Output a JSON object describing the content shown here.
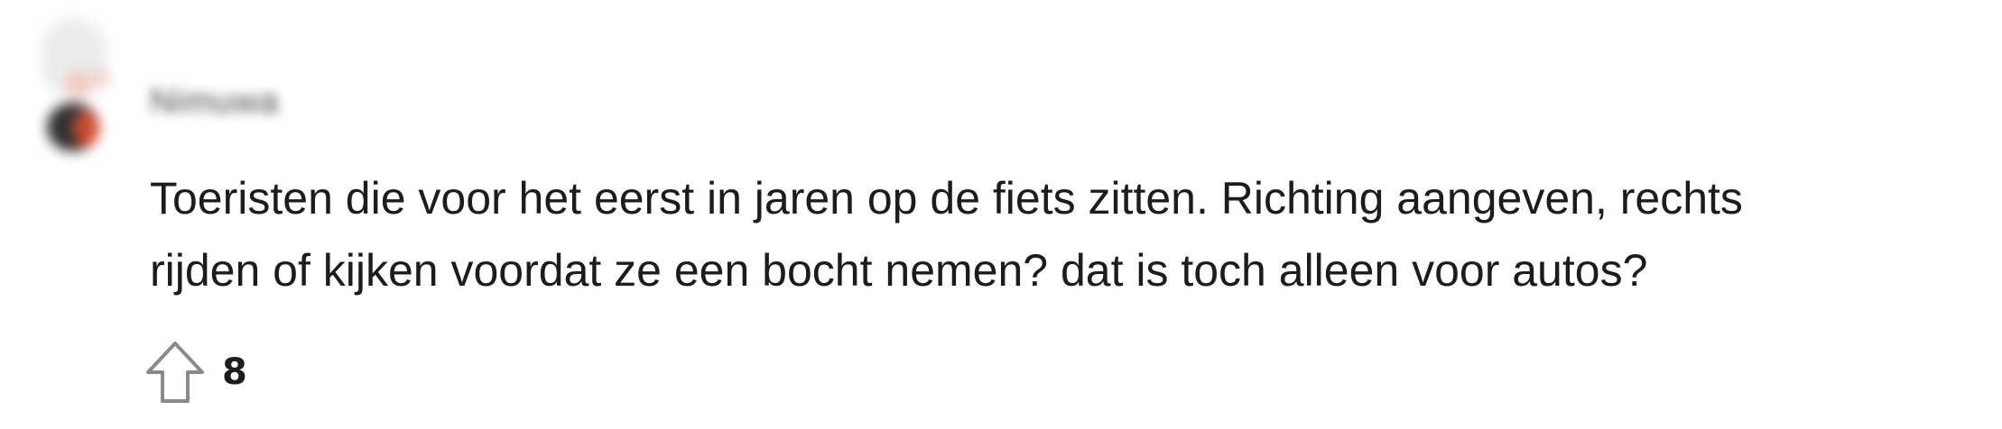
{
  "comment": {
    "username": "Nimuwa",
    "text_line_1": "Toeristen die voor het eerst in jaren op de fiets zitten. Richting aangeven, rechts",
    "text_line_2": "rijden of kijken voordat ze een bocht nemen? dat is toch alleen voor autos?",
    "vote_count": "8",
    "avatar_icon": "user-avatar-icon",
    "upvote_icon": "upvote-arrow-icon"
  },
  "colors": {
    "text": "#1c1c1c",
    "upvote_stroke": "#8a8a8a",
    "background": "#ffffff"
  }
}
